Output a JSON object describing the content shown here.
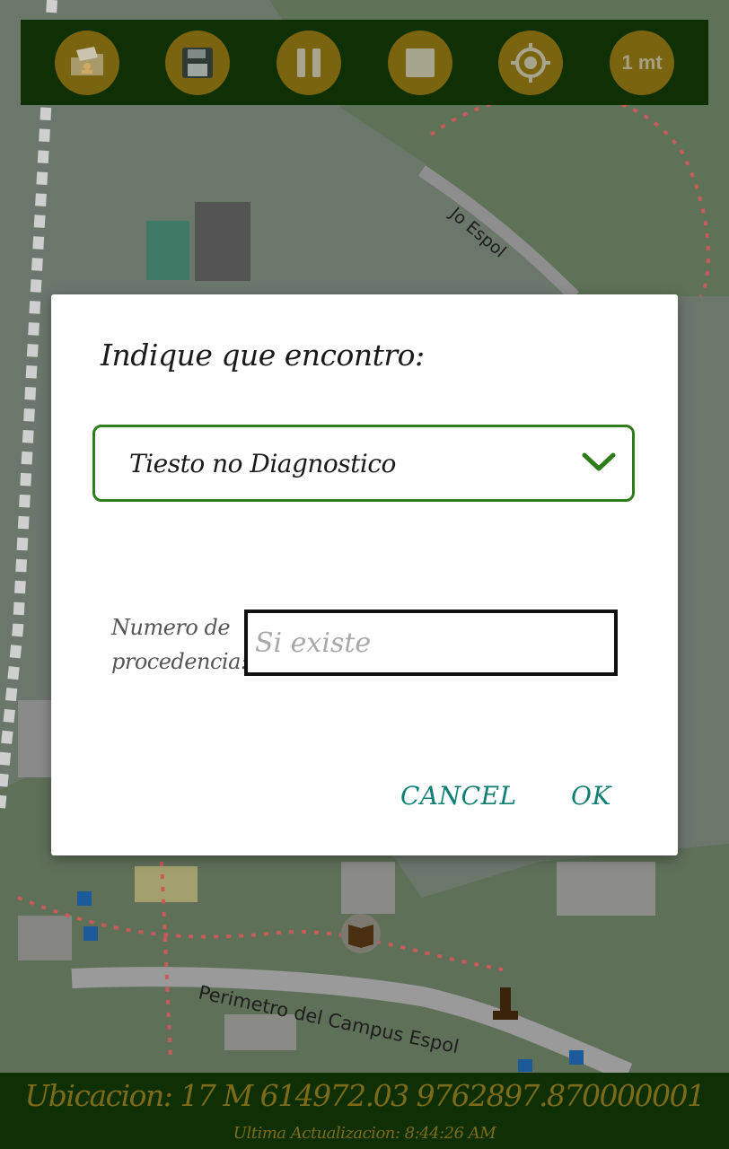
{
  "toolbar": {
    "buttons": [
      {
        "icon": "folder-user-icon"
      },
      {
        "icon": "save-icon"
      },
      {
        "icon": "pause-icon"
      },
      {
        "icon": "stop-icon"
      },
      {
        "icon": "locate-target-icon"
      },
      {
        "icon": "distance-text",
        "label": "1 mt"
      }
    ],
    "bg_color": "#0f2f04",
    "button_color": "#7a6410"
  },
  "map": {
    "labels": {
      "road_top": "Jo Espol",
      "road_bottom": "Perimetro del Campus Espol"
    }
  },
  "dialog": {
    "title": "Indique que encontro:",
    "spinner_value": "Tiesto no Diagnostico",
    "field_label": "Numero de procedencia:",
    "field_placeholder": "Si existe",
    "field_value": "",
    "cancel_label": "CANCEL",
    "ok_label": "OK",
    "accent_color": "#0f7f73",
    "border_color": "#2e7d1a"
  },
  "status": {
    "location": "Ubicacion: 17 M 614972.03 9762897.870000001",
    "updated": "Ultima Actualizacion: 8:44:26 AM"
  }
}
